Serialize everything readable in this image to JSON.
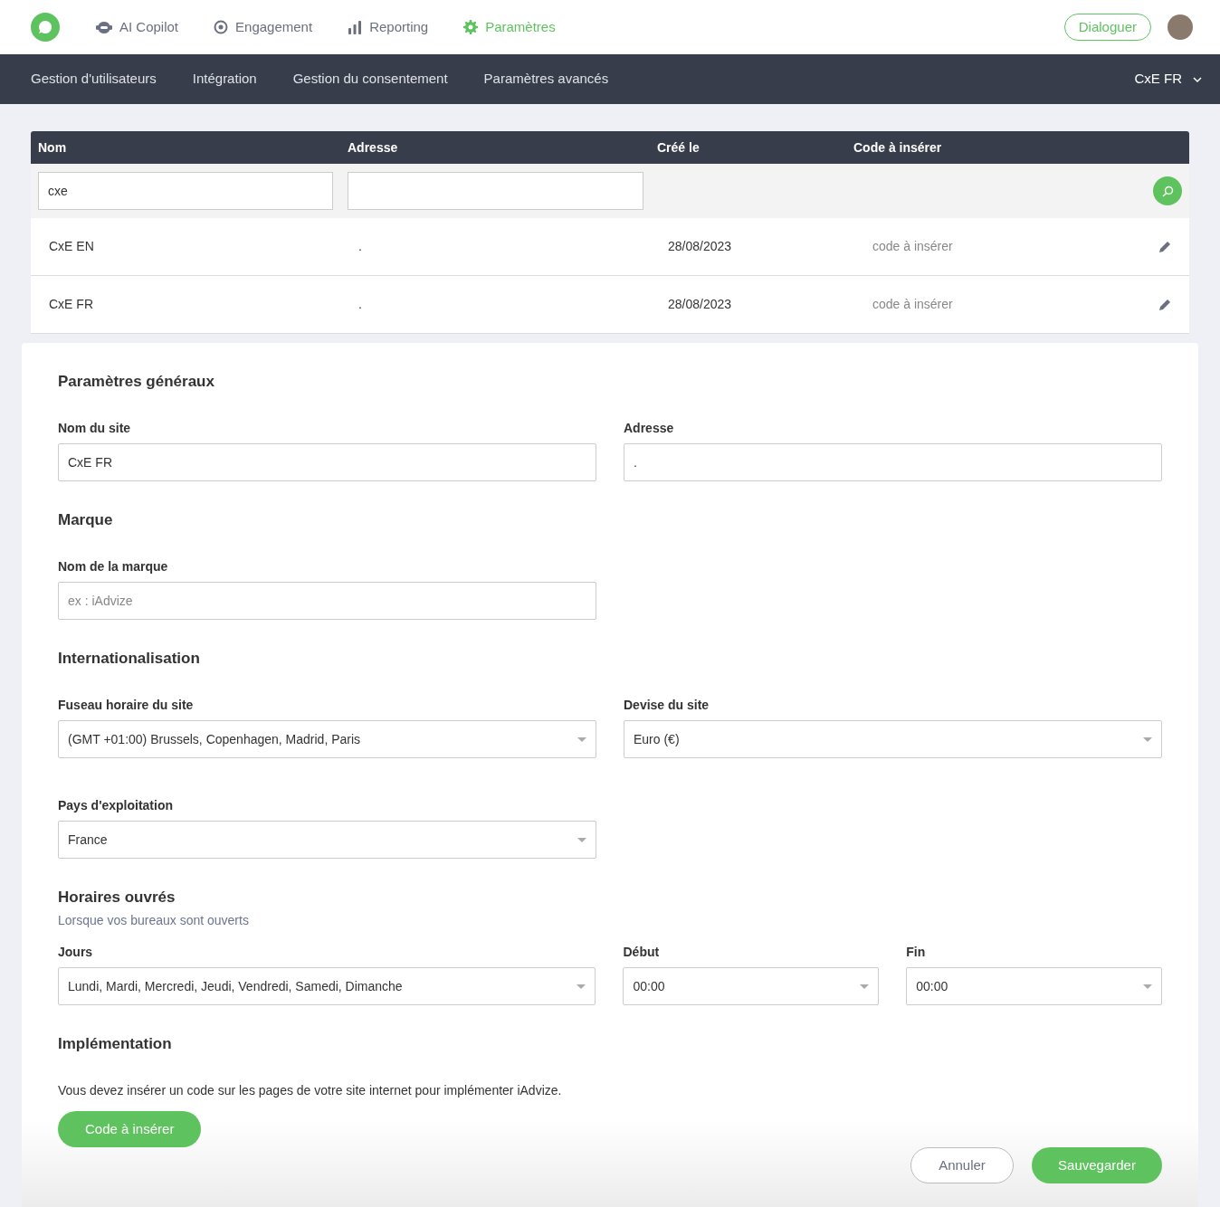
{
  "top_nav": {
    "items": [
      {
        "label": "AI Copilot",
        "selected": false
      },
      {
        "label": "Engagement",
        "selected": false
      },
      {
        "label": "Reporting",
        "selected": false
      },
      {
        "label": "Paramètres",
        "selected": true
      }
    ],
    "dialog_button": "Dialoguer"
  },
  "sub_nav": {
    "items": [
      "Gestion d'utilisateurs",
      "Intégration",
      "Gestion du consentement",
      "Paramètres avancés"
    ],
    "site_selector": "CxE FR"
  },
  "table": {
    "columns": [
      "Nom",
      "Adresse",
      "Créé le",
      "Code à insérer"
    ],
    "name_filter": "cxe",
    "rows": [
      {
        "name": "CxE EN",
        "address": ".",
        "created": "28/08/2023",
        "code": "code à insérer"
      },
      {
        "name": "CxE FR",
        "address": ".",
        "created": "28/08/2023",
        "code": "code à insérer"
      }
    ]
  },
  "form": {
    "sections": [
      {
        "title": "Paramètres généraux",
        "rows": [
          [
            {
              "label": "Nom du site",
              "kind": "input",
              "value": "CxE FR"
            },
            {
              "label": "Adresse",
              "kind": "input",
              "value": "."
            }
          ]
        ]
      },
      {
        "title": "Marque",
        "rows": [
          [
            {
              "label": "Nom de la marque",
              "kind": "input",
              "placeholder": "ex : iAdvize"
            }
          ]
        ]
      },
      {
        "title": "Internationalisation",
        "rows": [
          [
            {
              "label": "Fuseau horaire du site",
              "kind": "select",
              "value": "(GMT +01:00) Brussels, Copenhagen, Madrid, Paris"
            },
            {
              "label": "Devise du site",
              "kind": "select",
              "value": "Euro (€)"
            }
          ],
          [
            {
              "label": "Pays d'exploitation",
              "kind": "select",
              "value": "France"
            }
          ]
        ]
      },
      {
        "title": "Horaires ouvrés",
        "subtitle": "Lorsque vos bureaux sont ouverts",
        "rows": [
          [
            {
              "label": "Jours",
              "kind": "select",
              "value": "Lundi, Mardi, Mercredi, Jeudi, Vendredi, Samedi, Dimanche"
            },
            {
              "label": "Début",
              "kind": "select",
              "value": "00:00"
            },
            {
              "label": "Fin",
              "kind": "select",
              "value": "00:00"
            }
          ]
        ]
      },
      {
        "title": "Implémentation",
        "text": "Vous devez insérer un code sur les pages de votre site internet pour implémenter iAdvize.",
        "button": "Code à insérer"
      }
    ],
    "cancel_button": "Annuler",
    "save_button": "Sauvegarder"
  }
}
